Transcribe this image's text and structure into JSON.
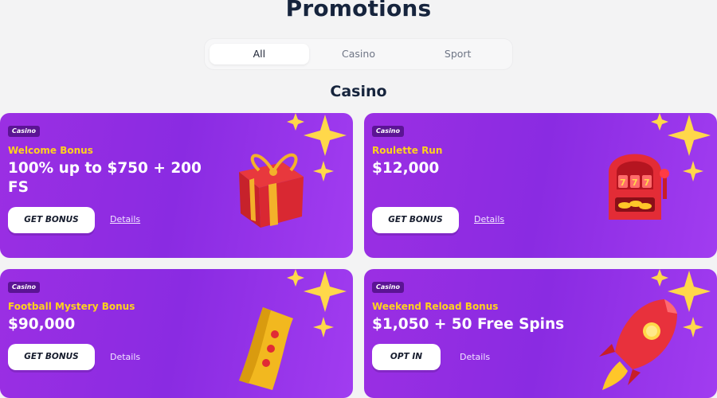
{
  "page": {
    "title": "Promotions"
  },
  "tabs": [
    {
      "label": "All",
      "active": true
    },
    {
      "label": "Casino",
      "active": false
    },
    {
      "label": "Sport",
      "active": false
    }
  ],
  "section": {
    "title": "Casino"
  },
  "cards": [
    {
      "badge": "Casino",
      "name": "Welcome Bonus",
      "amount": "100% up to $750 + 200 FS",
      "button": "GET BONUS",
      "details": "Details",
      "art_icon": "gift-box-icon"
    },
    {
      "badge": "Casino",
      "name": "Roulette Run",
      "amount": "$12,000",
      "button": "GET BONUS",
      "details": "Details",
      "art_icon": "slot-machine-icon"
    },
    {
      "badge": "Casino",
      "name": "Football Mystery Bonus",
      "amount": "$90,000",
      "button": "GET BONUS",
      "details": "Details",
      "art_icon": "ticket-icon"
    },
    {
      "badge": "Casino",
      "name": "Weekend Reload Bonus",
      "amount": "$1,050 + 50 Free Spins",
      "button": "OPT IN",
      "details": "Details",
      "art_icon": "rocket-icon"
    }
  ],
  "colors": {
    "card_gradient_start": "#9b2fe3",
    "card_gradient_end": "#a13cf0",
    "promo_name": "#ffd21e",
    "badge_bg": "#5b1494",
    "title": "#16243d"
  }
}
